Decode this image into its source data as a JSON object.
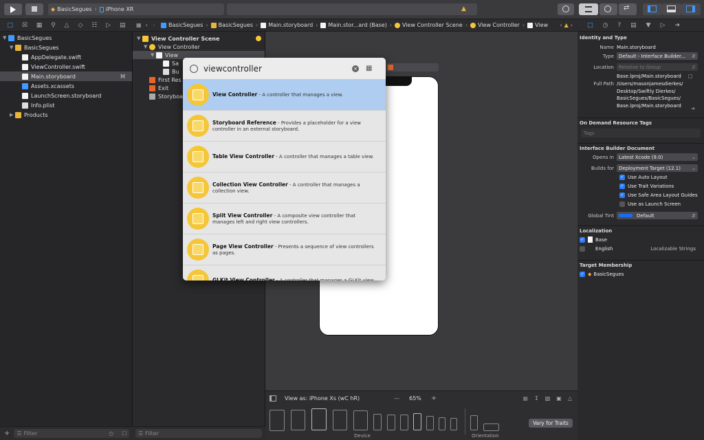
{
  "toolbar": {
    "scheme": "BasicSegues",
    "device": "iPhone XR"
  },
  "navigator": {
    "items": [
      {
        "label": "BasicSegues",
        "level": 0,
        "kind": "project",
        "expanded": true
      },
      {
        "label": "BasicSegues",
        "level": 1,
        "kind": "folder",
        "expanded": true
      },
      {
        "label": "AppDelegate.swift",
        "level": 2,
        "kind": "swift"
      },
      {
        "label": "ViewController.swift",
        "level": 2,
        "kind": "swift"
      },
      {
        "label": "Main.storyboard",
        "level": 2,
        "kind": "storyboard",
        "selected": true,
        "badge": "M"
      },
      {
        "label": "Assets.xcassets",
        "level": 2,
        "kind": "assets"
      },
      {
        "label": "LaunchScreen.storyboard",
        "level": 2,
        "kind": "storyboard"
      },
      {
        "label": "Info.plist",
        "level": 2,
        "kind": "plist"
      },
      {
        "label": "Products",
        "level": 1,
        "kind": "folder",
        "expanded": false
      }
    ],
    "filter_placeholder": "Filter"
  },
  "jumpbar": {
    "crumbs": [
      "BasicSegues",
      "BasicSegues",
      "Main.storyboard",
      "Main.stor...ard (Base)",
      "View Controller Scene",
      "View Controller",
      "View"
    ]
  },
  "outline": {
    "items": [
      {
        "label": "View Controller Scene",
        "level": 0
      },
      {
        "label": "View Controller",
        "level": 1
      },
      {
        "label": "View",
        "level": 2
      },
      {
        "label": "Sa",
        "level": 3
      },
      {
        "label": "Bu",
        "level": 3
      },
      {
        "label": "First Res",
        "level": 1
      },
      {
        "label": "Exit",
        "level": 1
      },
      {
        "label": "Storyboa",
        "level": 1
      }
    ],
    "filter_placeholder": "Filter"
  },
  "library": {
    "query": "viewcontroller",
    "items": [
      {
        "title": "View Controller",
        "desc": " - A controller that manages a view."
      },
      {
        "title": "Storyboard Reference",
        "desc": " - Provides a placeholder for a view controller in an external storyboard."
      },
      {
        "title": "Table View Controller",
        "desc": " - A controller that manages a table view."
      },
      {
        "title": "Collection View Controller",
        "desc": " - A controller that manages a collection view."
      },
      {
        "title": "Split View Controller",
        "desc": " - A composite view controller that manages left and right view controllers."
      },
      {
        "title": "Page View Controller",
        "desc": " - Presents a sequence of view controllers as pages."
      },
      {
        "title": "GLKit View Controller",
        "desc": " - A controller that manages a GLKit view."
      }
    ]
  },
  "canvas": {
    "view_as": "View as: iPhone Xs (wC hR)",
    "zoom": "65%",
    "minus": "—",
    "plus": "+",
    "device_label": "Device",
    "orientation_label": "Orientation",
    "vary_button": "Vary for Traits"
  },
  "inspector": {
    "identity_header": "Identity and Type",
    "name_label": "Name",
    "name_value": "Main.storyboard",
    "type_label": "Type",
    "type_value": "Default - Interface Builder...",
    "location_label": "Location",
    "location_value": "Relative to Group",
    "location_file": "Base.lproj/Main.storyboard",
    "fullpath_label": "Full Path",
    "fullpath_lines": [
      "/Users/masonjamesdierkes/",
      "Desktop/Swiftly Dierkes/",
      "BasicSegues/BasicSegues/",
      "Base.lproj/Main.storyboard"
    ],
    "ondemand_header": "On Demand Resource Tags",
    "tags_placeholder": "Tags",
    "ibdoc_header": "Interface Builder Document",
    "opens_label": "Opens in",
    "opens_value": "Latest Xcode (9.0)",
    "builds_label": "Builds for",
    "builds_value": "Deployment Target (12.1)",
    "checks": [
      {
        "label": "Use Auto Layout",
        "checked": true
      },
      {
        "label": "Use Trait Variations",
        "checked": true
      },
      {
        "label": "Use Safe Area Layout Guides",
        "checked": true
      },
      {
        "label": "Use as Launch Screen",
        "checked": false
      }
    ],
    "tint_label": "Global Tint",
    "tint_value": "Default",
    "tint_color": "#1a6df0",
    "localization_header": "Localization",
    "loc_items": [
      {
        "label": "Base",
        "checked": true,
        "extra": ""
      },
      {
        "label": "English",
        "checked": false,
        "extra": "Localizable Strings"
      }
    ],
    "membership_header": "Target Membership",
    "membership_item": "BasicSegues"
  }
}
